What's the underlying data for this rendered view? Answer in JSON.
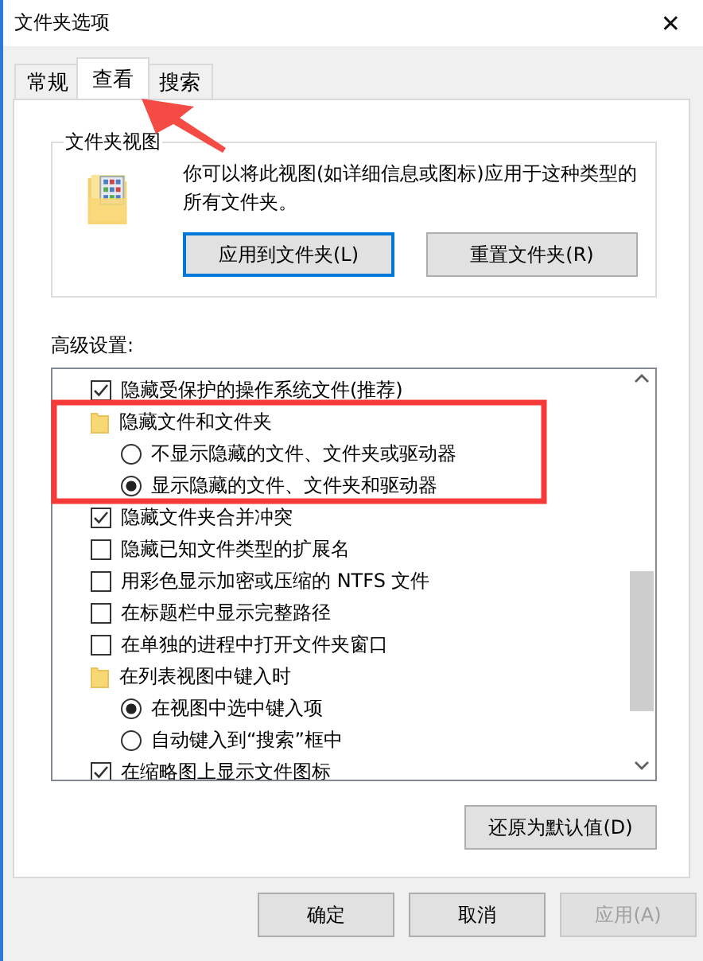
{
  "window": {
    "title": "文件夹选项",
    "close": "✕"
  },
  "tabs": [
    {
      "label": "常规",
      "selected": false
    },
    {
      "label": "查看",
      "selected": true
    },
    {
      "label": "搜索",
      "selected": false
    }
  ],
  "folder_views": {
    "title": "文件夹视图",
    "description": "你可以将此视图(如详细信息或图标)应用于这种类型的所有文件夹。",
    "buttons": [
      {
        "label": "应用到文件夹(L)",
        "focused": true
      },
      {
        "label": "重置文件夹(R)",
        "focused": false
      }
    ]
  },
  "advanced": {
    "title": "高级设置:",
    "items": [
      {
        "kind": "checkbox",
        "label": "隐藏受保护的操作系统文件(推荐)",
        "checked": true
      },
      {
        "kind": "folder",
        "label": "隐藏文件和文件夹",
        "children": [
          {
            "kind": "radio",
            "label": "不显示隐藏的文件、文件夹或驱动器",
            "selected": false
          },
          {
            "kind": "radio",
            "label": "显示隐藏的文件、文件夹和驱动器",
            "selected": true
          }
        ]
      },
      {
        "kind": "checkbox",
        "label": "隐藏文件夹合并冲突",
        "checked": true
      },
      {
        "kind": "checkbox",
        "label": "隐藏已知文件类型的扩展名",
        "checked": false
      },
      {
        "kind": "checkbox",
        "label": "用彩色显示加密或压缩的 NTFS 文件",
        "checked": false
      },
      {
        "kind": "checkbox",
        "label": "在标题栏中显示完整路径",
        "checked": false
      },
      {
        "kind": "checkbox",
        "label": "在单独的进程中打开文件夹窗口",
        "checked": false
      },
      {
        "kind": "folder",
        "label": "在列表视图中键入时",
        "children": [
          {
            "kind": "radio",
            "label": "在视图中选中键入项",
            "selected": true
          },
          {
            "kind": "radio",
            "label": "自动键入到“搜索”框中",
            "selected": false
          }
        ]
      },
      {
        "kind": "checkbox",
        "label": "在缩略图上显示文件图标",
        "checked": true
      }
    ],
    "restore_button": "还原为默认值(D)"
  },
  "buttons": [
    {
      "label": "确定",
      "disabled": false
    },
    {
      "label": "取消",
      "disabled": false
    },
    {
      "label": "应用(A)",
      "disabled": true
    }
  ]
}
